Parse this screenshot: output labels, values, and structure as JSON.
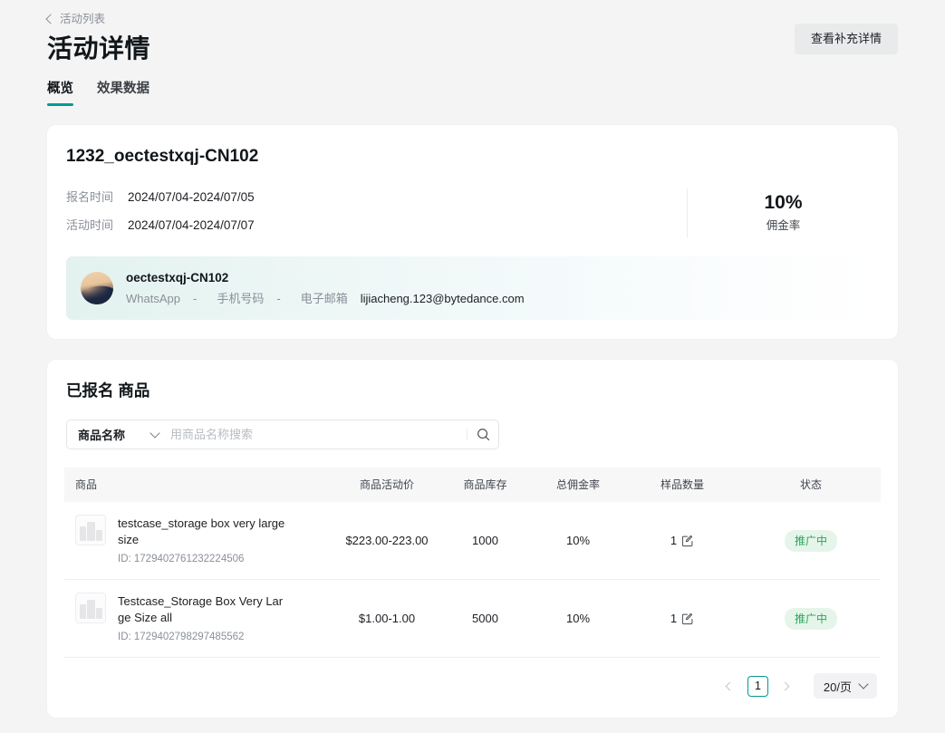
{
  "header": {
    "breadcrumb": "活动列表",
    "title": "活动详情",
    "action_label": "查看补充详情"
  },
  "tabs": [
    {
      "label": "概览",
      "active": true
    },
    {
      "label": "效果数据",
      "active": false
    }
  ],
  "detail": {
    "title": "1232_oectestxqj-CN102",
    "meta": [
      {
        "label": "报名时间",
        "value": "2024/07/04-2024/07/05"
      },
      {
        "label": "活动时间",
        "value": "2024/07/04-2024/07/07"
      }
    ],
    "stat": {
      "value": "10%",
      "label": "佣金率"
    },
    "creator": {
      "name": "oectestxqj-CN102",
      "whatsapp_label": "WhatsApp",
      "whatsapp_value": "-",
      "phone_label": "手机号码",
      "phone_value": "-",
      "email_label": "电子邮箱",
      "email_value": "lijiacheng.123@bytedance.com"
    }
  },
  "products": {
    "title": "已报名 商品",
    "search": {
      "select_value": "商品名称",
      "placeholder": "用商品名称搜索",
      "input_value": "",
      "search_icon": "search-icon",
      "chevron_icon": "chevron-down-icon"
    },
    "columns": [
      "商品",
      "商品活动价",
      "商品库存",
      "总佣金率",
      "样品数量",
      "状态"
    ],
    "rows": [
      {
        "name": "testcase_storage box very large size",
        "id": "ID: 1729402761232224506",
        "price": "$223.00-223.00",
        "stock": "1000",
        "commission": "10%",
        "sample_qty": "1",
        "status": "推广中"
      },
      {
        "name": "Testcase_Storage Box Very Large Size all",
        "id": "ID: 1729402798297485562",
        "price": "$1.00-1.00",
        "stock": "5000",
        "commission": "10%",
        "sample_qty": "1",
        "status": "推广中"
      }
    ],
    "pagination": {
      "current_page": "1",
      "page_size": "20/页",
      "prev_icon": "chevron-left-icon",
      "next_icon": "chevron-right-icon"
    }
  },
  "colors": {
    "accent": "#009a96",
    "status_text": "#2aa65a",
    "status_bg": "#e6f5ea",
    "page_bg": "#f4f4f4"
  }
}
